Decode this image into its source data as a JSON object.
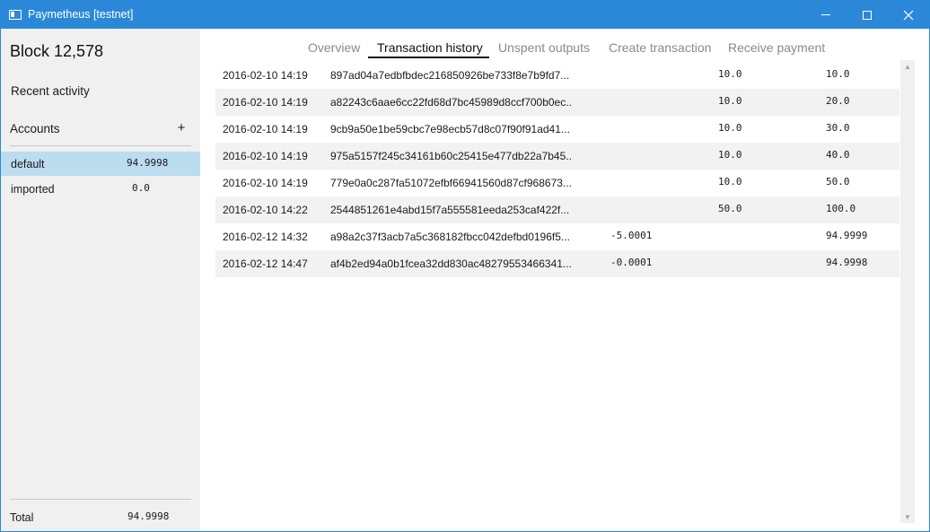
{
  "window": {
    "title": "Paymetheus [testnet]"
  },
  "sidebar": {
    "block": "Block 12,578",
    "recent_activity": "Recent activity",
    "accounts_label": "Accounts",
    "add_account_symbol": "+",
    "accounts": [
      {
        "name": "default",
        "balance": "94.9998",
        "selected": true
      },
      {
        "name": "imported",
        "balance": "0.0",
        "selected": false
      }
    ],
    "total_label": "Total",
    "total_value": "94.9998"
  },
  "tabs": [
    {
      "label": "Overview",
      "active": false
    },
    {
      "label": "Transaction history",
      "active": true
    },
    {
      "label": "Unspent outputs",
      "active": false
    },
    {
      "label": "Create transaction",
      "active": false
    },
    {
      "label": "Receive payment",
      "active": false
    }
  ],
  "transactions": [
    {
      "date": "2016-02-10 14:19",
      "hash": "897ad04a7edbfbdec216850926be733f8e7b9fd7...",
      "change": "",
      "amount": "10.0",
      "balance": "10.0"
    },
    {
      "date": "2016-02-10 14:19",
      "hash": "a82243c6aae6cc22fd68d7bc45989d8ccf700b0ec...",
      "change": "",
      "amount": "10.0",
      "balance": "20.0"
    },
    {
      "date": "2016-02-10 14:19",
      "hash": "9cb9a50e1be59cbc7e98ecb57d8c07f90f91ad41...",
      "change": "",
      "amount": "10.0",
      "balance": "30.0"
    },
    {
      "date": "2016-02-10 14:19",
      "hash": "975a5157f245c34161b60c25415e477db22a7b45...",
      "change": "",
      "amount": "10.0",
      "balance": "40.0"
    },
    {
      "date": "2016-02-10 14:19",
      "hash": "779e0a0c287fa51072efbf66941560d87cf968673...",
      "change": "",
      "amount": "10.0",
      "balance": "50.0"
    },
    {
      "date": "2016-02-10 14:22",
      "hash": "2544851261e4abd15f7a555581eeda253caf422f...",
      "change": "",
      "amount": "50.0",
      "balance": "100.0"
    },
    {
      "date": "2016-02-12 14:32",
      "hash": "a98a2c37f3acb7a5c368182fbcc042defbd0196f5...",
      "change": "-5.0001",
      "amount": "",
      "balance": "94.9999"
    },
    {
      "date": "2016-02-12 14:47",
      "hash": "af4b2ed94a0b1fcea32dd830ac48279553466341...",
      "change": "-0.0001",
      "amount": "",
      "balance": "94.9998"
    }
  ],
  "colors": {
    "titlebar": "#2b88d8",
    "sidebar_bg": "#f0f0f0",
    "selected_account": "#bcdcf0",
    "row_alt": "#f2f2f2"
  },
  "icons": {
    "app": "window-icon",
    "minimize": "minimize-icon",
    "maximize": "maximize-icon",
    "close": "close-icon",
    "add": "plus-icon",
    "scroll_up": "chevron-up-icon",
    "scroll_down": "chevron-down-icon"
  }
}
